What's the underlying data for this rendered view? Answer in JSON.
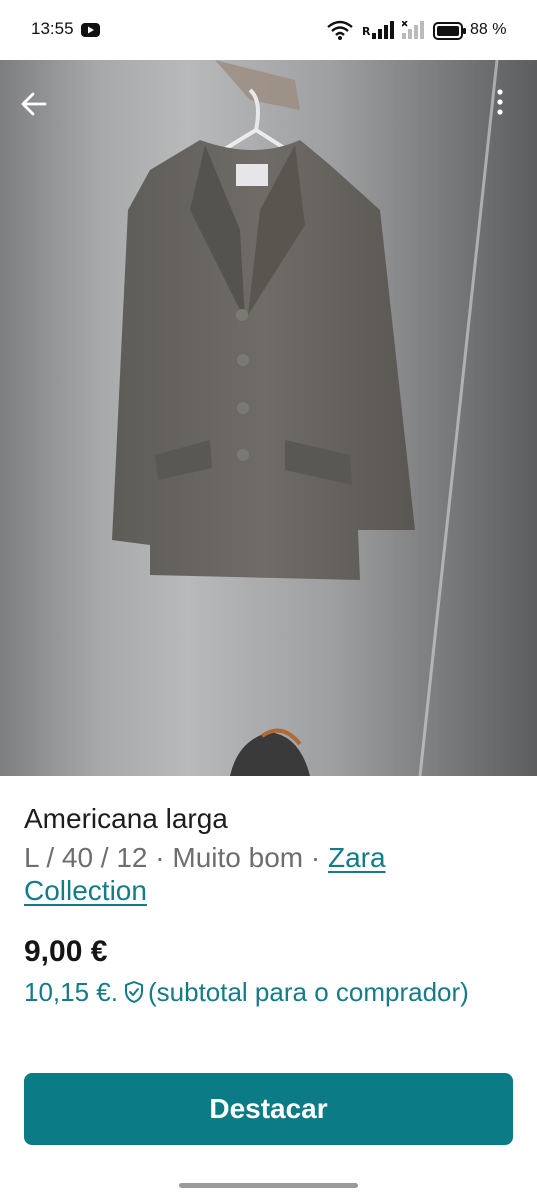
{
  "status_bar": {
    "time": "13:55",
    "battery": "88 %",
    "icons": [
      "youtube-icon",
      "wifi-icon",
      "signal-icon",
      "battery-icon"
    ]
  },
  "photo": {
    "subject": "grey blazer on hanger",
    "carousel": {
      "count": 2,
      "active": 0
    }
  },
  "item": {
    "title": "Americana larga",
    "meta_prefix": "L / 40 / 12 · Muito bom · ",
    "brand": "Zara Collection",
    "price": "9,00 €",
    "buyer_price": "10,15 €.",
    "buyer_note": "(subtotal para o comprador)"
  },
  "actions": {
    "highlight_label": "Destacar"
  },
  "colors": {
    "accent": "#0b7c86",
    "link": "#137c87",
    "muted": "#6e6e6e"
  }
}
